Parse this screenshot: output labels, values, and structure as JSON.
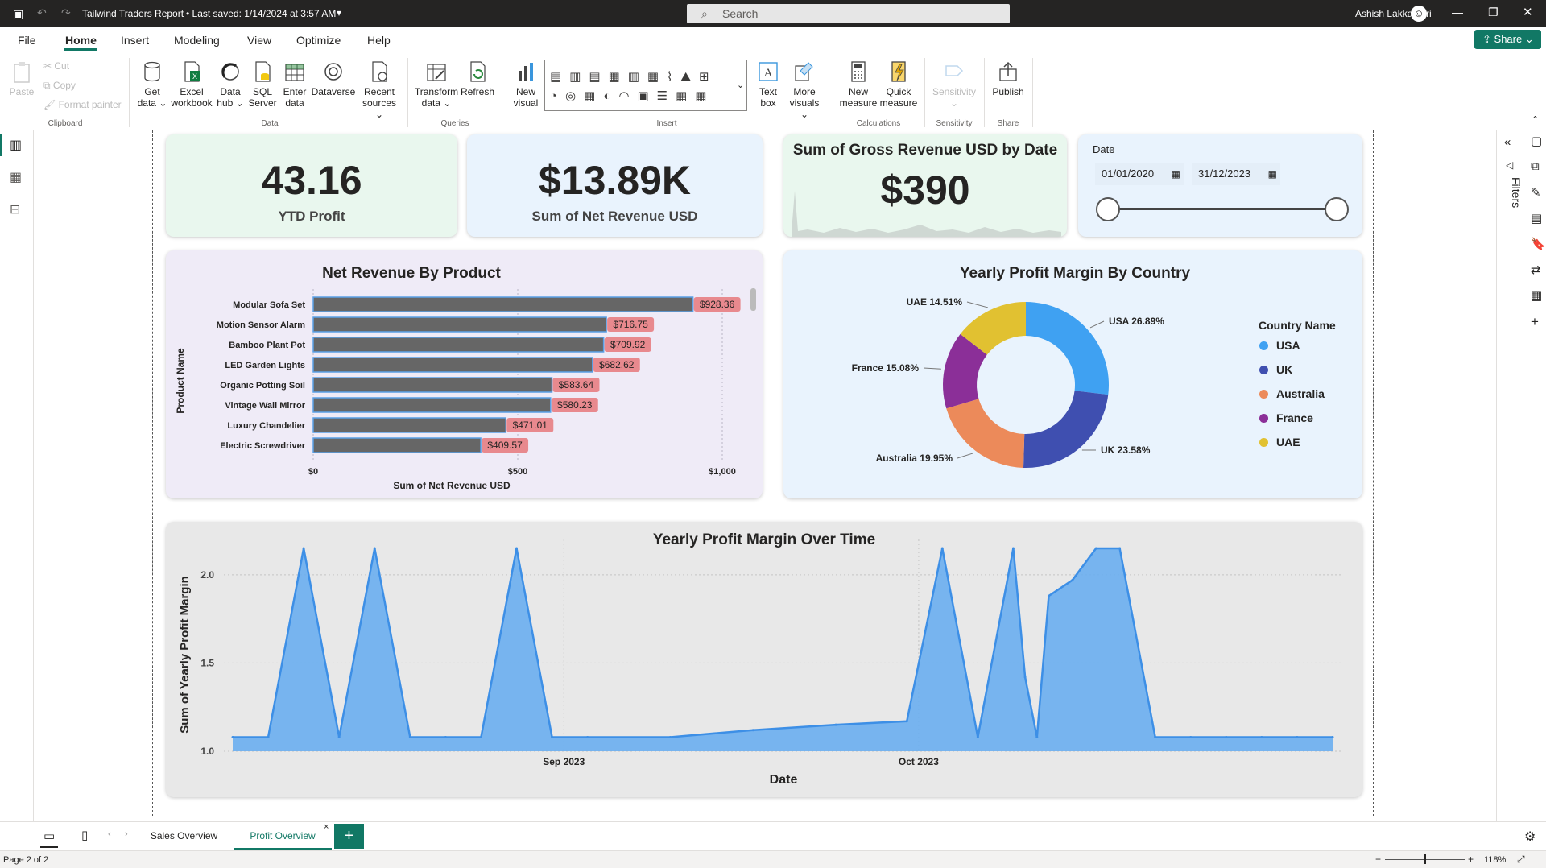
{
  "titlebar": {
    "file_title": "Tailwind Traders Report",
    "saved_status": "• Last saved: 1/14/2024 at 3:57 AM",
    "search_placeholder": "Search",
    "user_name": "Ashish Lakkapatri"
  },
  "menu": {
    "tabs": [
      "File",
      "Home",
      "Insert",
      "Modeling",
      "View",
      "Optimize",
      "Help"
    ],
    "active": "Home",
    "share": "Share"
  },
  "ribbon": {
    "clipboard": {
      "paste": "Paste",
      "cut": "Cut",
      "copy": "Copy",
      "format_painter": "Format painter",
      "group": "Clipboard"
    },
    "data": {
      "get_data": [
        "Get",
        "data ⌄"
      ],
      "excel": [
        "Excel",
        "workbook"
      ],
      "data_hub": [
        "Data",
        "hub ⌄"
      ],
      "sql": [
        "SQL",
        "Server"
      ],
      "enter": [
        "Enter",
        "data"
      ],
      "dataverse": [
        "Dataverse",
        ""
      ],
      "recent": [
        "Recent",
        "sources ⌄"
      ],
      "group": "Data"
    },
    "queries": {
      "transform": [
        "Transform",
        "data ⌄"
      ],
      "refresh": [
        "Refresh",
        ""
      ],
      "group": "Queries"
    },
    "insert": {
      "new_visual": [
        "New",
        "visual"
      ],
      "text_box": [
        "Text",
        "box"
      ],
      "more_visuals": [
        "More",
        "visuals ⌄"
      ],
      "group": "Insert"
    },
    "calculations": {
      "new_measure": [
        "New",
        "measure"
      ],
      "quick_measure": [
        "Quick",
        "measure"
      ],
      "group": "Calculations"
    },
    "sensitivity": {
      "label": [
        "Sensitivity",
        "⌄"
      ],
      "group": "Sensitivity"
    },
    "share": {
      "publish": [
        "Publish",
        ""
      ],
      "group": "Share"
    }
  },
  "kpis": {
    "ytd_profit": {
      "value": "43.16",
      "label": "YTD Profit"
    },
    "net_revenue": {
      "value": "$13.89K",
      "label": "Sum of Net Revenue USD"
    },
    "gross_revenue": {
      "title": "Sum of Gross Revenue USD by Date",
      "value": "$390"
    }
  },
  "date_slicer": {
    "title": "Date",
    "start": "01/01/2020",
    "end": "31/12/2023"
  },
  "filters_pane": {
    "label": "Filters"
  },
  "chart_data": [
    {
      "type": "bar",
      "title": "Net Revenue By Product",
      "xlabel": "Sum of Net Revenue USD",
      "ylabel": "Product Name",
      "categories": [
        "Modular Sofa Set",
        "Motion Sensor Alarm",
        "Bamboo Plant Pot",
        "LED Garden Lights",
        "Organic Potting Soil",
        "Vintage Wall Mirror",
        "Luxury Chandelier",
        "Electric Screwdriver"
      ],
      "values": [
        928.36,
        716.75,
        709.92,
        682.62,
        583.64,
        580.23,
        471.01,
        409.57
      ],
      "data_labels": [
        "$928.36",
        "$716.75",
        "$709.92",
        "$682.62",
        "$583.64",
        "$580.23",
        "$471.01",
        "$409.57"
      ],
      "xticks": [
        "$0",
        "$500",
        "$1,000"
      ],
      "xlim": [
        0,
        1000
      ],
      "colors": {
        "bar": "#666666",
        "outline": "#5aa0e6",
        "label_bg": "#e8898e"
      }
    },
    {
      "type": "pie",
      "title": "Yearly Profit Margin By Country",
      "legend_title": "Country Name",
      "categories": [
        "USA",
        "UK",
        "Australia",
        "France",
        "UAE"
      ],
      "values": [
        26.89,
        23.58,
        19.95,
        15.08,
        14.51
      ],
      "data_labels": [
        "USA 26.89%",
        "UK 23.58%",
        "Australia 19.95%",
        "France 15.08%",
        "UAE 14.51%"
      ],
      "colors": [
        "#3fa1f2",
        "#3f4fb0",
        "#ec8a5a",
        "#8b2f98",
        "#e1c131"
      ],
      "legend_position": "right"
    },
    {
      "type": "area",
      "title": "Yearly Profit Margin Over Time",
      "xlabel": "Date",
      "ylabel": "Sum of Yearly Profit Margin",
      "x": [
        "2023-08-04",
        "2023-08-07",
        "2023-08-10",
        "2023-08-13",
        "2023-08-16",
        "2023-08-19",
        "2023-08-22",
        "2023-08-25",
        "2023-08-28",
        "2023-08-31",
        "2023-09-03",
        "2023-09-10",
        "2023-09-17",
        "2023-09-24",
        "2023-09-30",
        "2023-10-03",
        "2023-10-06",
        "2023-10-09",
        "2023-10-10",
        "2023-10-11",
        "2023-10-12",
        "2023-10-14",
        "2023-10-16",
        "2023-10-18",
        "2023-10-21",
        "2023-10-24",
        "2023-10-27",
        "2023-10-30",
        "2023-11-02",
        "2023-11-05"
      ],
      "values": [
        1.08,
        1.08,
        2.15,
        1.08,
        2.15,
        1.08,
        1.08,
        1.08,
        2.15,
        1.08,
        1.08,
        1.08,
        1.12,
        1.15,
        1.17,
        2.15,
        1.08,
        2.15,
        1.42,
        1.08,
        1.88,
        1.97,
        2.15,
        2.15,
        1.08,
        1.08,
        1.08,
        1.08,
        1.08,
        1.08
      ],
      "yticks": [
        "1.0",
        "1.5",
        "2.0"
      ],
      "ylim": [
        1.0,
        2.2
      ],
      "xticks": [
        "Sep 2023",
        "Oct 2023"
      ],
      "grid": true,
      "color": "#6aaef0"
    }
  ],
  "pages": {
    "tabs": [
      "Sales Overview",
      "Profit Overview"
    ],
    "active": "Profit Overview",
    "status": "Page 2 of 2",
    "zoom": "118%"
  }
}
